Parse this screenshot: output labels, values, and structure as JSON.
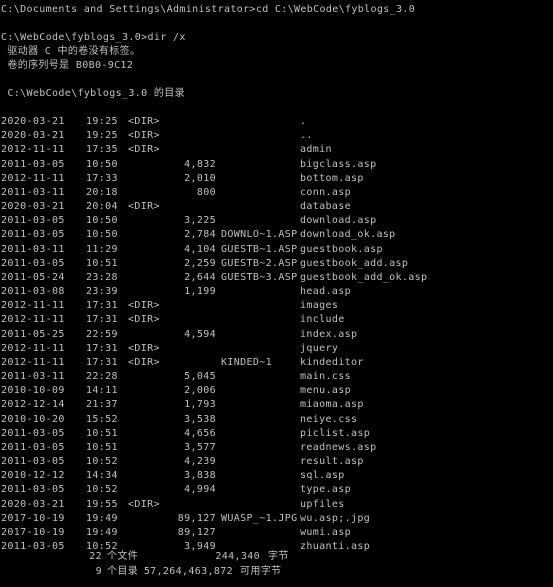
{
  "console": {
    "prompt_line": "C:\\Documents and Settings\\Administrator>cd C:\\WebCode\\fyblogs_3.0",
    "dir_command": "C:\\WebCode\\fyblogs_3.0>dir /x",
    "volume_line": " 驱动器 C 中的卷没有标签。",
    "serial_line": " 卷的序列号是 B0B0-9C12",
    "directory_of": " C:\\WebCode\\fyblogs_3.0 的目录",
    "entries": [
      {
        "date": "2020-03-21",
        "time": "19:25",
        "dir": "<DIR>",
        "size": "",
        "short": "",
        "name": "."
      },
      {
        "date": "2020-03-21",
        "time": "19:25",
        "dir": "<DIR>",
        "size": "",
        "short": "",
        "name": ".."
      },
      {
        "date": "2012-11-11",
        "time": "17:35",
        "dir": "<DIR>",
        "size": "",
        "short": "",
        "name": "admin"
      },
      {
        "date": "2011-03-05",
        "time": "10:50",
        "dir": "",
        "size": "4,832",
        "short": "",
        "name": "bigclass.asp"
      },
      {
        "date": "2012-11-11",
        "time": "17:33",
        "dir": "",
        "size": "2,010",
        "short": "",
        "name": "bottom.asp"
      },
      {
        "date": "2011-03-11",
        "time": "20:18",
        "dir": "",
        "size": "800",
        "short": "",
        "name": "conn.asp"
      },
      {
        "date": "2020-03-21",
        "time": "20:04",
        "dir": "<DIR>",
        "size": "",
        "short": "",
        "name": "database"
      },
      {
        "date": "2011-03-05",
        "time": "10:50",
        "dir": "",
        "size": "3,225",
        "short": "",
        "name": "download.asp"
      },
      {
        "date": "2011-03-05",
        "time": "10:50",
        "dir": "",
        "size": "2,784",
        "short": "DOWNLO~1.ASP",
        "name": "download_ok.asp"
      },
      {
        "date": "2011-03-11",
        "time": "11:29",
        "dir": "",
        "size": "4,104",
        "short": "GUESTB~1.ASP",
        "name": "guestbook.asp"
      },
      {
        "date": "2011-03-05",
        "time": "10:51",
        "dir": "",
        "size": "2,259",
        "short": "GUESTB~2.ASP",
        "name": "guestbook_add.asp"
      },
      {
        "date": "2011-05-24",
        "time": "23:28",
        "dir": "",
        "size": "2,644",
        "short": "GUESTB~3.ASP",
        "name": "guestbook_add_ok.asp"
      },
      {
        "date": "2011-03-08",
        "time": "23:39",
        "dir": "",
        "size": "1,199",
        "short": "",
        "name": "head.asp"
      },
      {
        "date": "2012-11-11",
        "time": "17:31",
        "dir": "<DIR>",
        "size": "",
        "short": "",
        "name": "images"
      },
      {
        "date": "2012-11-11",
        "time": "17:31",
        "dir": "<DIR>",
        "size": "",
        "short": "",
        "name": "include"
      },
      {
        "date": "2011-05-25",
        "time": "22:59",
        "dir": "",
        "size": "4,594",
        "short": "",
        "name": "index.asp"
      },
      {
        "date": "2012-11-11",
        "time": "17:31",
        "dir": "<DIR>",
        "size": "",
        "short": "",
        "name": "jquery"
      },
      {
        "date": "2012-11-11",
        "time": "17:31",
        "dir": "<DIR>",
        "size": "",
        "short": "KINDED~1",
        "name": "kindeditor"
      },
      {
        "date": "2011-03-11",
        "time": "22:28",
        "dir": "",
        "size": "5,045",
        "short": "",
        "name": "main.css"
      },
      {
        "date": "2010-10-09",
        "time": "14:11",
        "dir": "",
        "size": "2,006",
        "short": "",
        "name": "menu.asp"
      },
      {
        "date": "2012-12-14",
        "time": "21:37",
        "dir": "",
        "size": "1,793",
        "short": "",
        "name": "miaoma.asp"
      },
      {
        "date": "2010-10-20",
        "time": "15:52",
        "dir": "",
        "size": "3,538",
        "short": "",
        "name": "neiye.css"
      },
      {
        "date": "2011-03-05",
        "time": "10:51",
        "dir": "",
        "size": "4,656",
        "short": "",
        "name": "piclist.asp"
      },
      {
        "date": "2011-03-05",
        "time": "10:51",
        "dir": "",
        "size": "3,577",
        "short": "",
        "name": "readnews.asp"
      },
      {
        "date": "2011-03-05",
        "time": "10:52",
        "dir": "",
        "size": "4,239",
        "short": "",
        "name": "result.asp"
      },
      {
        "date": "2010-12-12",
        "time": "14:34",
        "dir": "",
        "size": "3,838",
        "short": "",
        "name": "sql.asp"
      },
      {
        "date": "2011-03-05",
        "time": "10:52",
        "dir": "",
        "size": "4,994",
        "short": "",
        "name": "type.asp"
      },
      {
        "date": "2020-03-21",
        "time": "19:55",
        "dir": "<DIR>",
        "size": "",
        "short": "",
        "name": "upfiles"
      },
      {
        "date": "2017-10-19",
        "time": "19:49",
        "dir": "",
        "size": "89,127",
        "short": "WUASP_~1.JPG",
        "name": "wu.asp;.jpg"
      },
      {
        "date": "2017-10-19",
        "time": "19:49",
        "dir": "",
        "size": "89,127",
        "short": "",
        "name": "wumi.asp"
      },
      {
        "date": "2011-03-05",
        "time": "10:52",
        "dir": "",
        "size": "3,949",
        "short": "",
        "name": "zhuanti.asp"
      }
    ],
    "summary": {
      "files_count": "22",
      "files_label": "个文件",
      "files_bytes": "244,340",
      "files_unit": "字节",
      "dirs_count": "9",
      "dirs_label": "个目录",
      "dirs_bytes": "57,264,463,872",
      "dirs_unit": "可用字节"
    }
  }
}
